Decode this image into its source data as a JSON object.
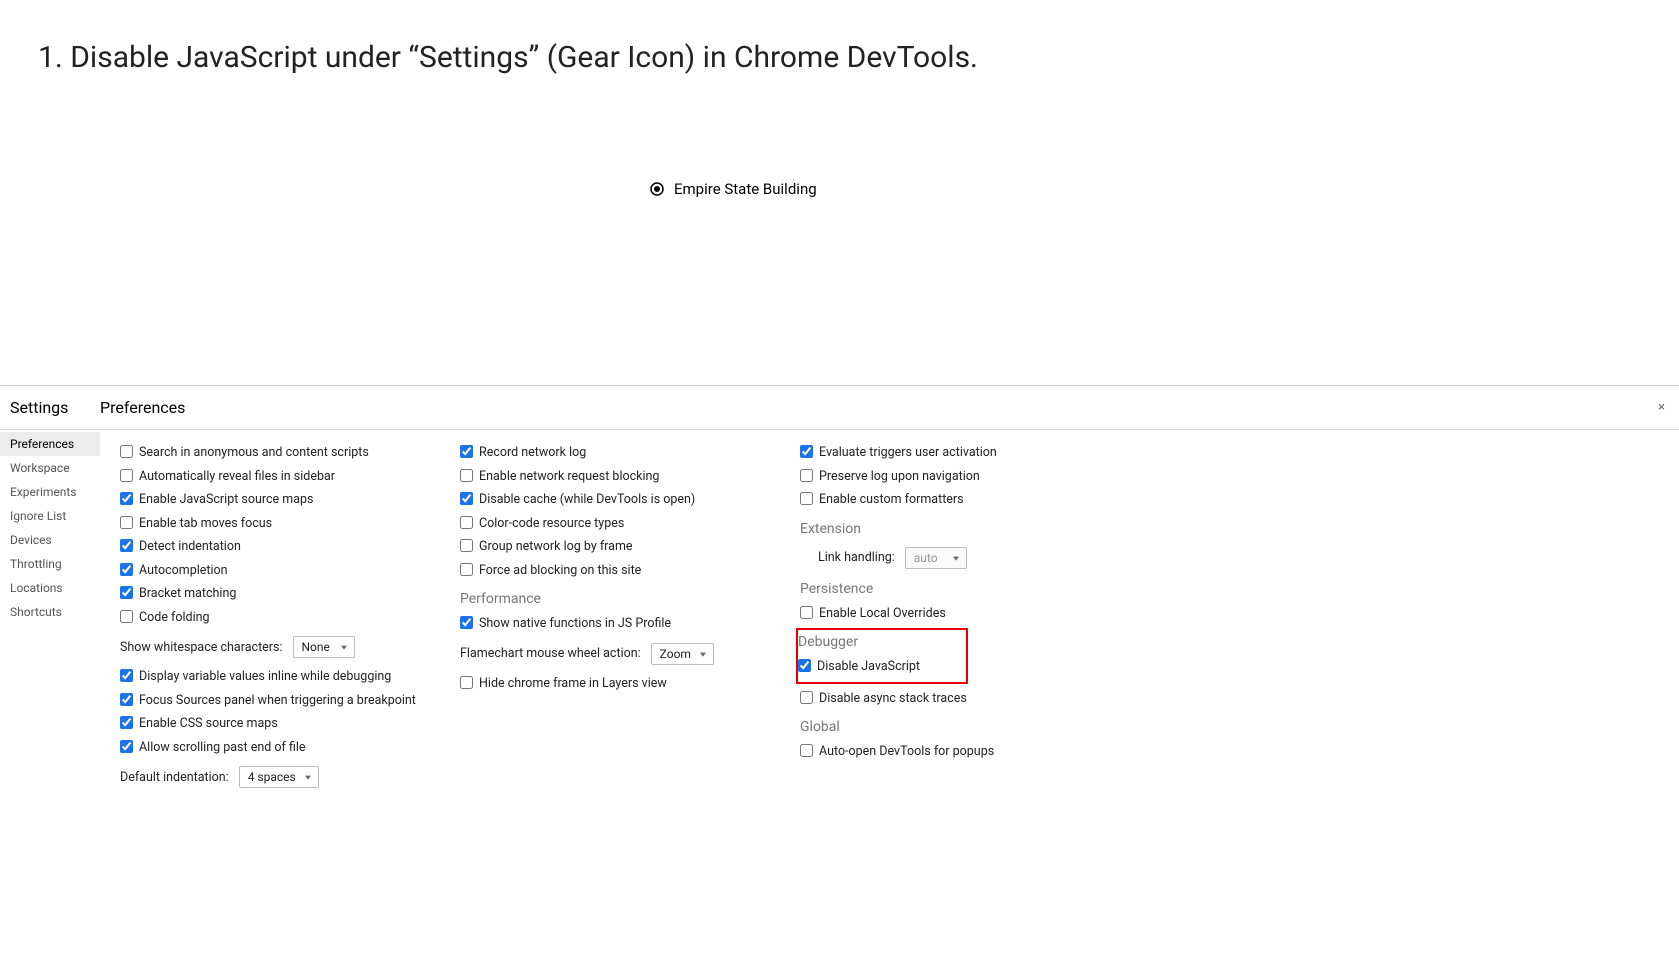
{
  "instruction": {
    "number": "1.",
    "text": "Disable JavaScript under “Settings” (Gear Icon) in Chrome DevTools."
  },
  "location": {
    "label": "Empire State Building"
  },
  "devtools": {
    "settings_title": "Settings",
    "preferences_title": "Preferences",
    "close_glyph": "×",
    "sidebar": [
      "Preferences",
      "Workspace",
      "Experiments",
      "Ignore List",
      "Devices",
      "Throttling",
      "Locations",
      "Shortcuts"
    ],
    "col1": {
      "options": [
        {
          "label": "Search in anonymous and content scripts",
          "checked": false
        },
        {
          "label": "Automatically reveal files in sidebar",
          "checked": false
        },
        {
          "label": "Enable JavaScript source maps",
          "checked": true
        },
        {
          "label": "Enable tab moves focus",
          "checked": false
        },
        {
          "label": "Detect indentation",
          "checked": true
        },
        {
          "label": "Autocompletion",
          "checked": true
        },
        {
          "label": "Bracket matching",
          "checked": true
        },
        {
          "label": "Code folding",
          "checked": false
        }
      ],
      "whitespace_label": "Show whitespace characters:",
      "whitespace_value": "None",
      "more_options": [
        {
          "label": "Display variable values inline while debugging",
          "checked": true
        },
        {
          "label": "Focus Sources panel when triggering a breakpoint",
          "checked": true
        },
        {
          "label": "Enable CSS source maps",
          "checked": true
        },
        {
          "label": "Allow scrolling past end of file",
          "checked": true
        }
      ],
      "indent_label": "Default indentation:",
      "indent_value": "4 spaces"
    },
    "col2": {
      "options": [
        {
          "label": "Record network log",
          "checked": true
        },
        {
          "label": "Enable network request blocking",
          "checked": false
        },
        {
          "label": "Disable cache (while DevTools is open)",
          "checked": true
        },
        {
          "label": "Color-code resource types",
          "checked": false
        },
        {
          "label": "Group network log by frame",
          "checked": false
        },
        {
          "label": "Force ad blocking on this site",
          "checked": false
        }
      ],
      "performance_heading": "Performance",
      "perf_options": [
        {
          "label": "Show native functions in JS Profile",
          "checked": true
        }
      ],
      "flamechart_label": "Flamechart mouse wheel action:",
      "flamechart_value": "Zoom",
      "layers_options": [
        {
          "label": "Hide chrome frame in Layers view",
          "checked": false
        }
      ]
    },
    "col3": {
      "options": [
        {
          "label": "Evaluate triggers user activation",
          "checked": true
        },
        {
          "label": "Preserve log upon navigation",
          "checked": false
        },
        {
          "label": "Enable custom formatters",
          "checked": false
        }
      ],
      "extension_heading": "Extension",
      "link_handling_label": "Link handling:",
      "link_handling_value": "auto",
      "persistence_heading": "Persistence",
      "persistence_options": [
        {
          "label": "Enable Local Overrides",
          "checked": false
        }
      ],
      "debugger_heading": "Debugger",
      "debugger_options": [
        {
          "label": "Disable JavaScript",
          "checked": true
        },
        {
          "label": "Disable async stack traces",
          "checked": false
        }
      ],
      "global_heading": "Global",
      "global_options": [
        {
          "label": "Auto-open DevTools for popups",
          "checked": false
        }
      ]
    }
  }
}
